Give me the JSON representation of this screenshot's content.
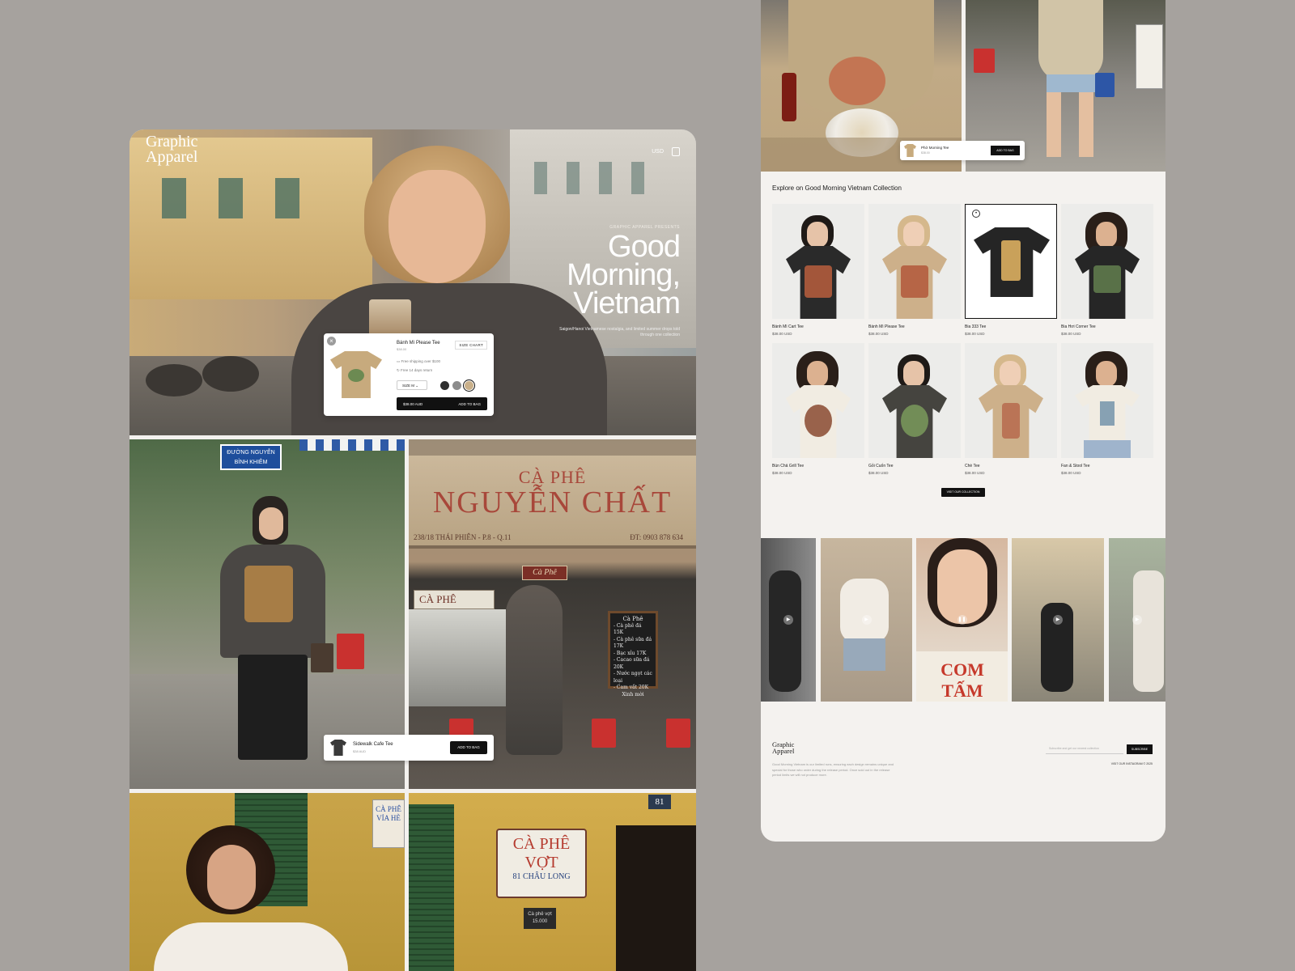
{
  "left": {
    "brand": {
      "line1": "Graphic",
      "line2": "Apparel"
    },
    "currency": "USD",
    "hero": {
      "presents": "GRAPHIC APPAREL PRESENTS",
      "title_l1": "Good",
      "title_l2": "Morning,",
      "title_l3": "Vietnam",
      "desc": "Saigon/Hanoi Vietnamese nostalgia, and limited summer drops told through one collection"
    },
    "quickview": {
      "name": "Bánh Mì Please Tee",
      "price": "$38.00",
      "size_chart": "SIZE CHART",
      "line1": "Free shipping over $100",
      "line2": "Free 14 days return",
      "size": "SIZE M",
      "price_btn": "$38.00 AUD",
      "add_btn": "ADD TO BAG",
      "swatches": [
        "#2f2f2f",
        "#8c8c8c",
        "#c9b08a"
      ]
    },
    "street_sign": "ĐƯỜNG NGUYỄN BỈNH KHIÊM",
    "cafe_sign": {
      "l1": "CÀ PHÊ",
      "l2": "NGUYỄN CHẤT",
      "addr": "238/18 THÁI PHIÊN - P.8 - Q.11",
      "phone": "ĐT: 0903 878 634",
      "small": "CÀ PHÊ",
      "hanging": "Cà Phê"
    },
    "chalk": [
      "Cà Phê",
      "- Cà phê đá 15K",
      "- Cà phê sữa đá 17K",
      "- Bạc xỉu 17K",
      "- Cacao sữa đá 20K",
      "- Nước ngọt các loại",
      "- Cam vắt 20K",
      "Xinh mời"
    ],
    "mini_bar": {
      "name": "Sidewalk Cafe Tee",
      "price": "$38 AUD",
      "btn": "ADD TO BAG"
    },
    "bottom": {
      "side_sign_l1": "CÀ PHÊ",
      "side_sign_l2": "VỈA HÈ",
      "sign_l1": "CÀ PHÊ",
      "sign_l2": "VỢT",
      "sign_l3": "81 CHÂU LONG",
      "number": "81",
      "small_sign": "Cà phê vợt 15.000"
    }
  },
  "right": {
    "mini_bar": {
      "name": "Phở Morning Tee",
      "price": "$38.00",
      "btn": "ADD TO BAG"
    },
    "explore_title": "Explore on Good Morning Vietnam Collection",
    "products": [
      {
        "name": "Bánh Mì Cart Tee",
        "price": "$38.00 USD"
      },
      {
        "name": "Bánh Mì Please Tee",
        "price": "$38.00 USD"
      },
      {
        "name": "Bia 333 Tee",
        "price": "$38.00 USD"
      },
      {
        "name": "Bia Hơi Corner Tee",
        "price": "$38.00 USD"
      },
      {
        "name": "Bún Chả Grill Tee",
        "price": "$38.00 USD"
      },
      {
        "name": "Gỏi Cuốn Tee",
        "price": "$38.00 USD"
      },
      {
        "name": "Chè Tee",
        "price": "$38.00 USD"
      },
      {
        "name": "Fan & Stool Tee",
        "price": "$38.00 USD"
      }
    ],
    "visit_btn": "VISIT OUR COLLECTION",
    "video_text": "COM TẤM",
    "footer": {
      "brand1": "Graphic",
      "brand2": "Apparel",
      "desc": "Good Morning Vietnam is our limited runs, ensuring each design remains unique and special for those who order during the release period. Once sold out in the release period limits we will not produce more.",
      "subscribe_placeholder": "Subscribe and get our newest collection",
      "subscribe_btn": "SUBSCRIBE",
      "links": "VISIT OUR INSTAGRAM   © 2025"
    }
  }
}
